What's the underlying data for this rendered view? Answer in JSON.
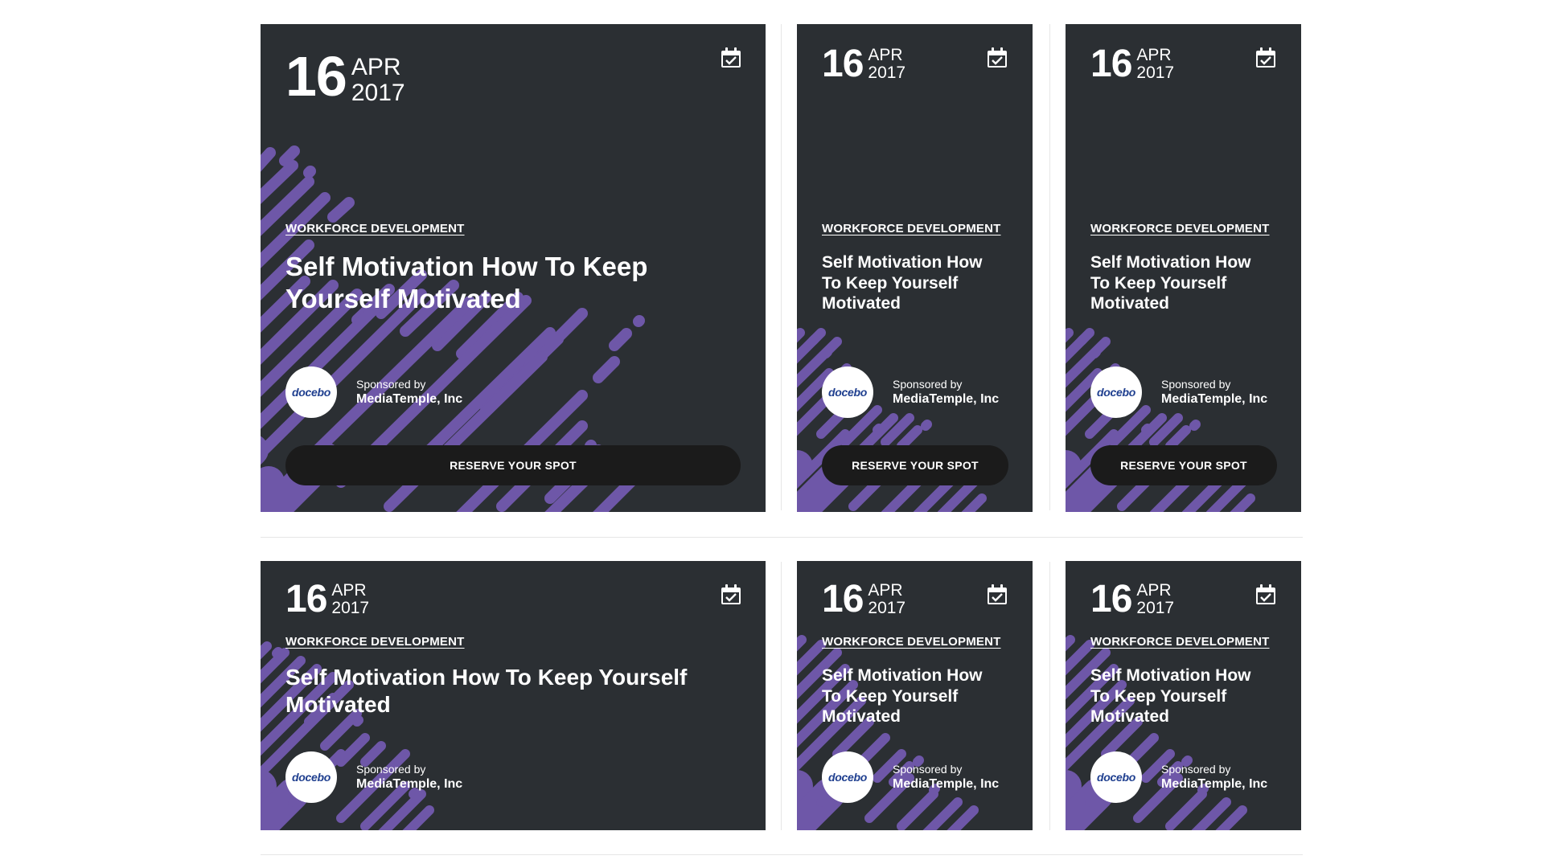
{
  "event": {
    "day": "16",
    "month": "APR",
    "year": "2017",
    "category": "WORKFORCE DEVELOPMENT",
    "title": "Self Motivation How To Keep Yourself Motivated",
    "sponsor_prefix": "Sponsored by",
    "sponsor_name": "MediaTemple, Inc",
    "sponsor_logo": "docebo",
    "cta": "RESERVE YOUR SPOT",
    "calendar_icon": "calendar-check-icon"
  },
  "colors": {
    "card_bg": "#2b2f33",
    "accent_purple": "#6e57a8",
    "button_bg": "#1b1b1b",
    "logo_text": "#1f3f8f"
  },
  "cards": [
    {
      "row": 1,
      "size": "wide",
      "has_button": true
    },
    {
      "row": 1,
      "size": "narrow",
      "has_button": true
    },
    {
      "row": 1,
      "size": "narrow",
      "has_button": true
    },
    {
      "row": 2,
      "size": "wide",
      "has_button": false
    },
    {
      "row": 2,
      "size": "narrow",
      "has_button": false
    },
    {
      "row": 2,
      "size": "narrow",
      "has_button": false
    }
  ]
}
